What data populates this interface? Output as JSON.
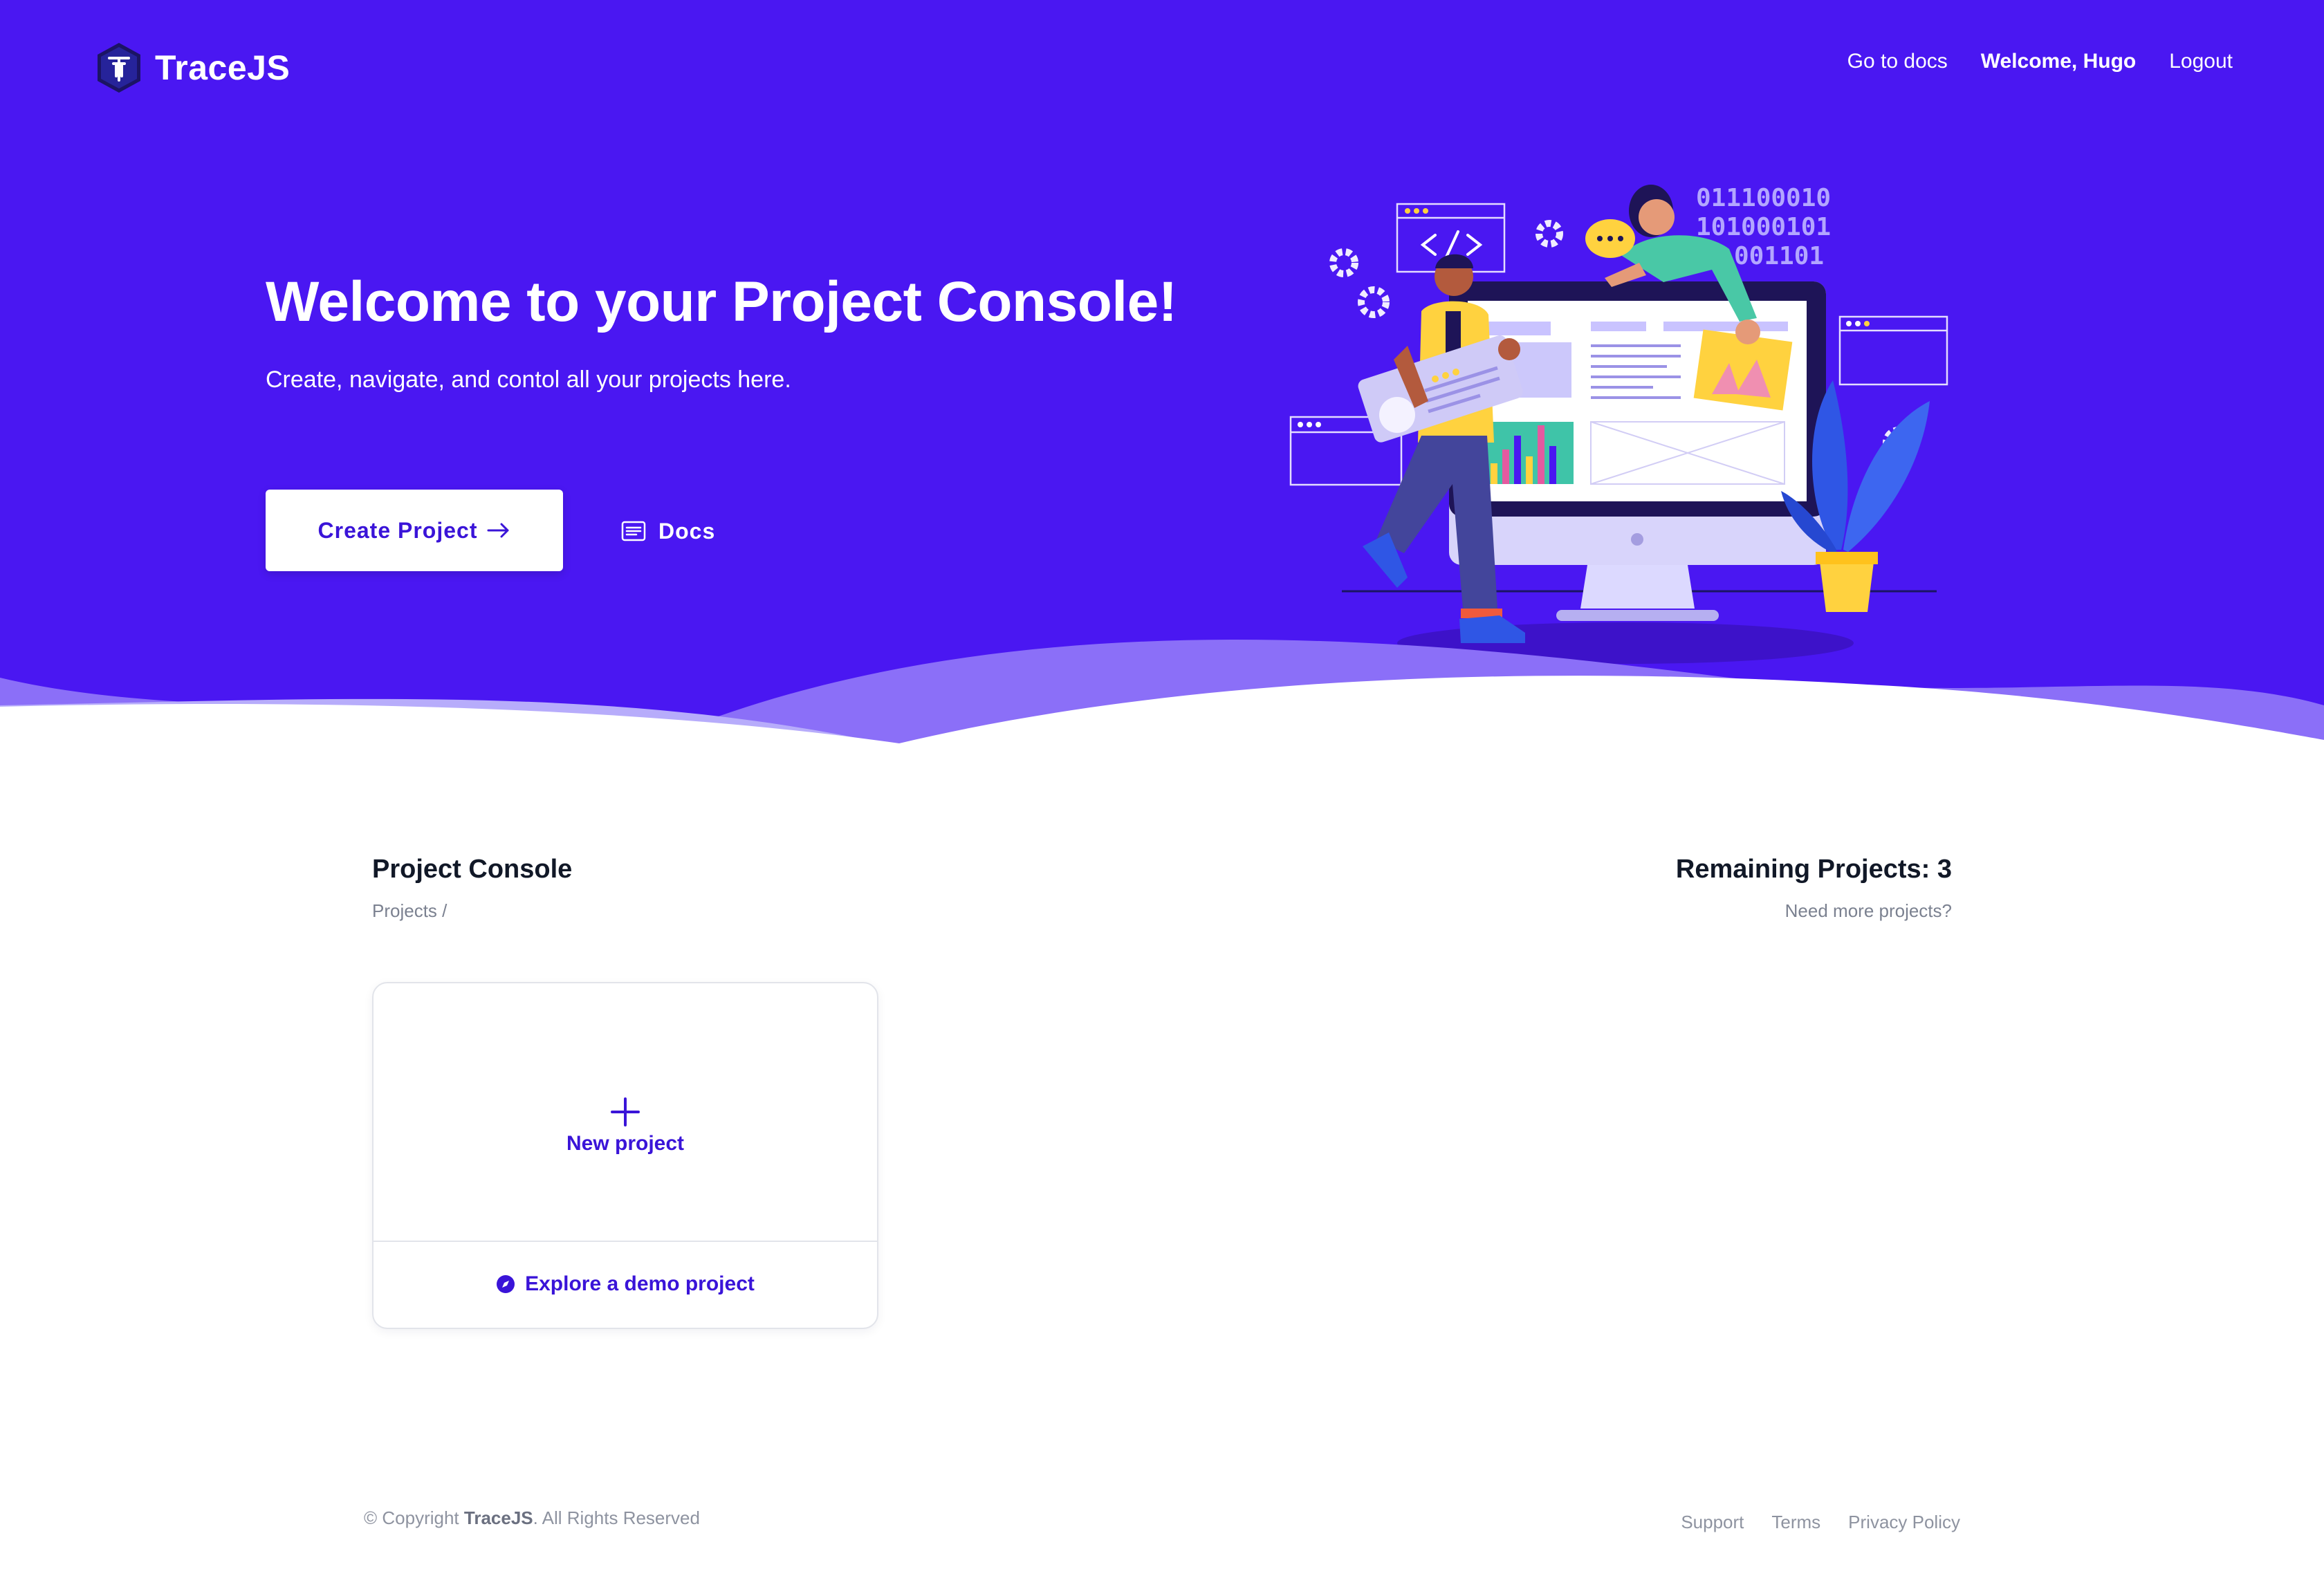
{
  "brand": {
    "name": "TraceJS",
    "logo_icon": "tracejs-hexagon-logo"
  },
  "nav": {
    "docs": "Go to docs",
    "welcome": "Welcome, Hugo",
    "logout": "Logout"
  },
  "hero": {
    "title": "Welcome to your Project Console!",
    "subtitle": "Create, navigate, and contol all your projects here.",
    "create_button": "Create Project",
    "create_icon": "arrow-right-icon",
    "docs_button": "Docs",
    "docs_icon": "document-icon",
    "binary_lines": [
      "011100010",
      "101000101",
      "001101"
    ],
    "illustration": "developers-at-monitor-illustration"
  },
  "console": {
    "title": "Project Console",
    "breadcrumb": "Projects  /",
    "remaining": "Remaining Projects: 3",
    "need_more": "Need more projects?"
  },
  "card": {
    "new_project": "New project",
    "new_icon": "plus-icon",
    "demo": "Explore a demo project",
    "demo_icon": "compass-icon"
  },
  "footer": {
    "copyright_prefix": "© Copyright ",
    "copyright_brand": "TraceJS",
    "copyright_suffix": ". All Rights Reserved",
    "links": [
      "Support",
      "Terms",
      "Privacy Policy"
    ]
  },
  "colors": {
    "primary": "#4a17f2",
    "accent_text": "#3a14d8",
    "muted": "#8e93a0"
  }
}
